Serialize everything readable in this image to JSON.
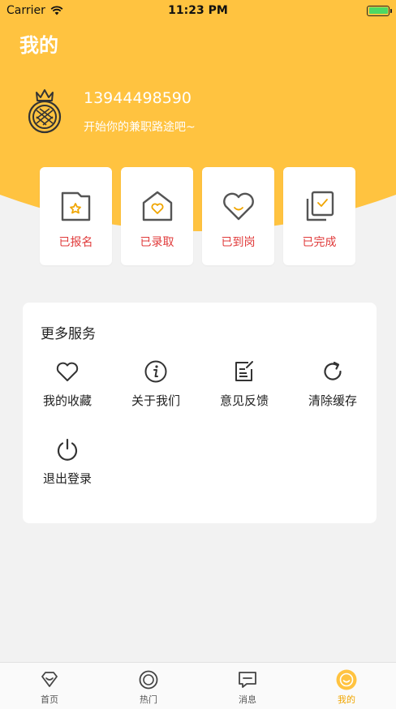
{
  "status_bar": {
    "carrier": "Carrier",
    "time": "11:23 PM"
  },
  "header": {
    "title": "我的"
  },
  "profile": {
    "phone": "13944498590",
    "slogan": "开始你的兼职路途吧~"
  },
  "status_cards": [
    {
      "label": "已报名",
      "icon": "folder-star-icon"
    },
    {
      "label": "已录取",
      "icon": "house-heart-icon"
    },
    {
      "label": "已到岗",
      "icon": "heart-smile-icon"
    },
    {
      "label": "已完成",
      "icon": "documents-check-icon"
    }
  ],
  "services": {
    "title": "更多服务",
    "items": [
      {
        "label": "我的收藏",
        "icon": "heart-icon"
      },
      {
        "label": "关于我们",
        "icon": "info-icon"
      },
      {
        "label": "意见反馈",
        "icon": "edit-note-icon"
      },
      {
        "label": "清除缓存",
        "icon": "refresh-icon"
      },
      {
        "label": "退出登录",
        "icon": "power-icon"
      }
    ]
  },
  "tabbar": {
    "items": [
      {
        "label": "首页",
        "icon": "home-diamond-icon"
      },
      {
        "label": "热门",
        "icon": "hot-circle-icon"
      },
      {
        "label": "消息",
        "icon": "message-icon"
      },
      {
        "label": "我的",
        "icon": "me-smile-icon",
        "active": true
      }
    ]
  },
  "colors": {
    "brand": "#ffc340",
    "accent_text": "#e03a3a",
    "active_tab": "#f0a500"
  }
}
